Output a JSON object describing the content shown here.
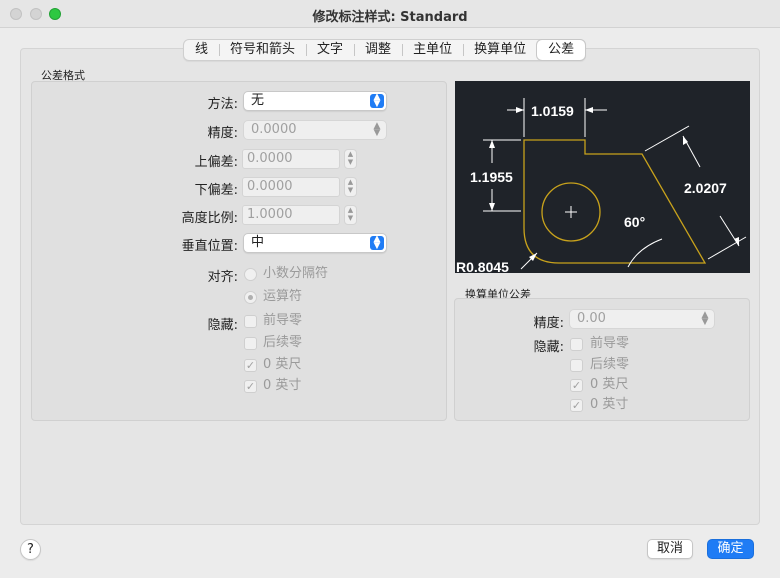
{
  "window": {
    "title": "修改标注样式: Standard"
  },
  "tabs": [
    {
      "label": "线"
    },
    {
      "label": "符号和箭头"
    },
    {
      "label": "文字"
    },
    {
      "label": "调整"
    },
    {
      "label": "主单位"
    },
    {
      "label": "换算单位"
    },
    {
      "label": "公差",
      "active": true
    }
  ],
  "tolerance_format": {
    "group_label": "公差格式",
    "method": {
      "label": "方法:",
      "value": "无"
    },
    "precision": {
      "label": "精度:",
      "value": "0.0000"
    },
    "upper_deviation": {
      "label": "上偏差:",
      "value": "0.0000"
    },
    "lower_deviation": {
      "label": "下偏差:",
      "value": "0.0000"
    },
    "height_scale": {
      "label": "高度比例:",
      "value": "1.0000"
    },
    "vertical_position": {
      "label": "垂直位置:",
      "value": "中"
    },
    "alignment": {
      "label": "对齐:",
      "options": [
        {
          "label": "小数分隔符",
          "checked": false
        },
        {
          "label": "运算符",
          "checked": true
        }
      ]
    },
    "suppress": {
      "label": "隐藏:",
      "options": [
        {
          "label": "前导零",
          "checked": false
        },
        {
          "label": "后续零",
          "checked": false
        },
        {
          "label": "0 英尺",
          "checked": true
        },
        {
          "label": "0 英寸",
          "checked": true
        }
      ]
    }
  },
  "preview": {
    "dim_top": "1.0159",
    "dim_left": "1.1955",
    "dim_right": "2.0207",
    "angle": "60°",
    "radius": "R0.8045",
    "colors": {
      "background": "#1f2329",
      "outline": "#c8a21c",
      "dimension": "#ffffff"
    }
  },
  "alt_units": {
    "group_label": "换算单位公差",
    "precision": {
      "label": "精度:",
      "value": "0.00"
    },
    "suppress": {
      "label": "隐藏:",
      "options": [
        {
          "label": "前导零",
          "checked": false
        },
        {
          "label": "后续零",
          "checked": false
        },
        {
          "label": "0 英尺",
          "checked": true
        },
        {
          "label": "0 英寸",
          "checked": true
        }
      ]
    }
  },
  "buttons": {
    "help": "?",
    "cancel": "取消",
    "ok": "确定"
  },
  "icons": {
    "stepper": "stepper-arrows-icon",
    "popup": "popup-arrows-icon",
    "check": "checkmark-icon"
  },
  "accent": "#1f7cf5"
}
